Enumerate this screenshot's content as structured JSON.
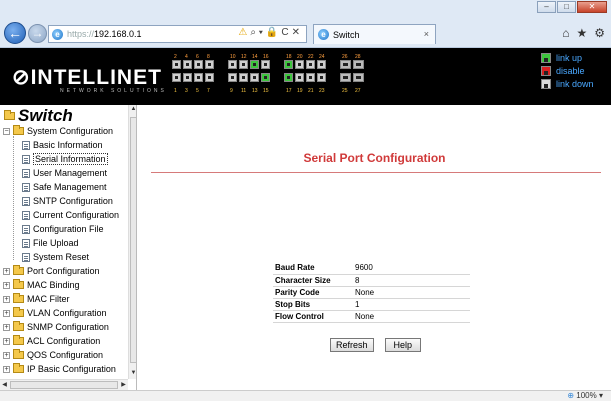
{
  "browser": {
    "url_proto": "https://",
    "url_host": "192.168.0.1",
    "tab_title": "Switch",
    "tab_close": "×",
    "window_buttons": [
      "–",
      "□",
      "✕"
    ],
    "nav_back": "←",
    "nav_forward": "→",
    "addr_tools": [
      "⚠",
      "⌕ ▾",
      "🔒",
      "C",
      "✕"
    ],
    "right_icons": [
      "⌂",
      "★",
      "⚙"
    ],
    "zoom": "100%"
  },
  "header": {
    "logo": "⊘INTELLINET",
    "logo_sub": "NETWORK SOLUTIONS",
    "port_numbers_top": [
      "2",
      "4",
      "6",
      "8",
      "10",
      "12",
      "14",
      "16",
      "18",
      "20",
      "22",
      "24",
      "26",
      "28"
    ],
    "port_numbers_bottom": [
      "1",
      "3",
      "5",
      "7",
      "9",
      "11",
      "13",
      "15",
      "17",
      "19",
      "21",
      "23",
      "25",
      "27"
    ],
    "legend": [
      {
        "label": "link up",
        "state": "up"
      },
      {
        "label": "disable",
        "state": "dis"
      },
      {
        "label": "link down",
        "state": "down"
      }
    ]
  },
  "sidebar": {
    "title": "Switch",
    "section": "System Configuration",
    "sub_items": [
      "Basic Information",
      "Serial Information",
      "User Management",
      "Safe Management",
      "SNTP Configuration",
      "Current Configuration",
      "Configuration File",
      "File Upload",
      "System Reset"
    ],
    "selected_index": 1,
    "top_items": [
      "Port Configuration",
      "MAC Binding",
      "MAC Filter",
      "VLAN Configuration",
      "SNMP Configuration",
      "ACL Configuration",
      "QOS Configuration",
      "IP Basic Configuration"
    ]
  },
  "main": {
    "title": "Serial Port Configuration",
    "rows": [
      {
        "label": "Baud Rate",
        "value": "9600"
      },
      {
        "label": "Character Size",
        "value": "8"
      },
      {
        "label": "Parity Code",
        "value": "None"
      },
      {
        "label": "Stop Bits",
        "value": "1"
      },
      {
        "label": "Flow Control",
        "value": "None"
      }
    ],
    "refresh_label": "Refresh",
    "help_label": "Help"
  }
}
